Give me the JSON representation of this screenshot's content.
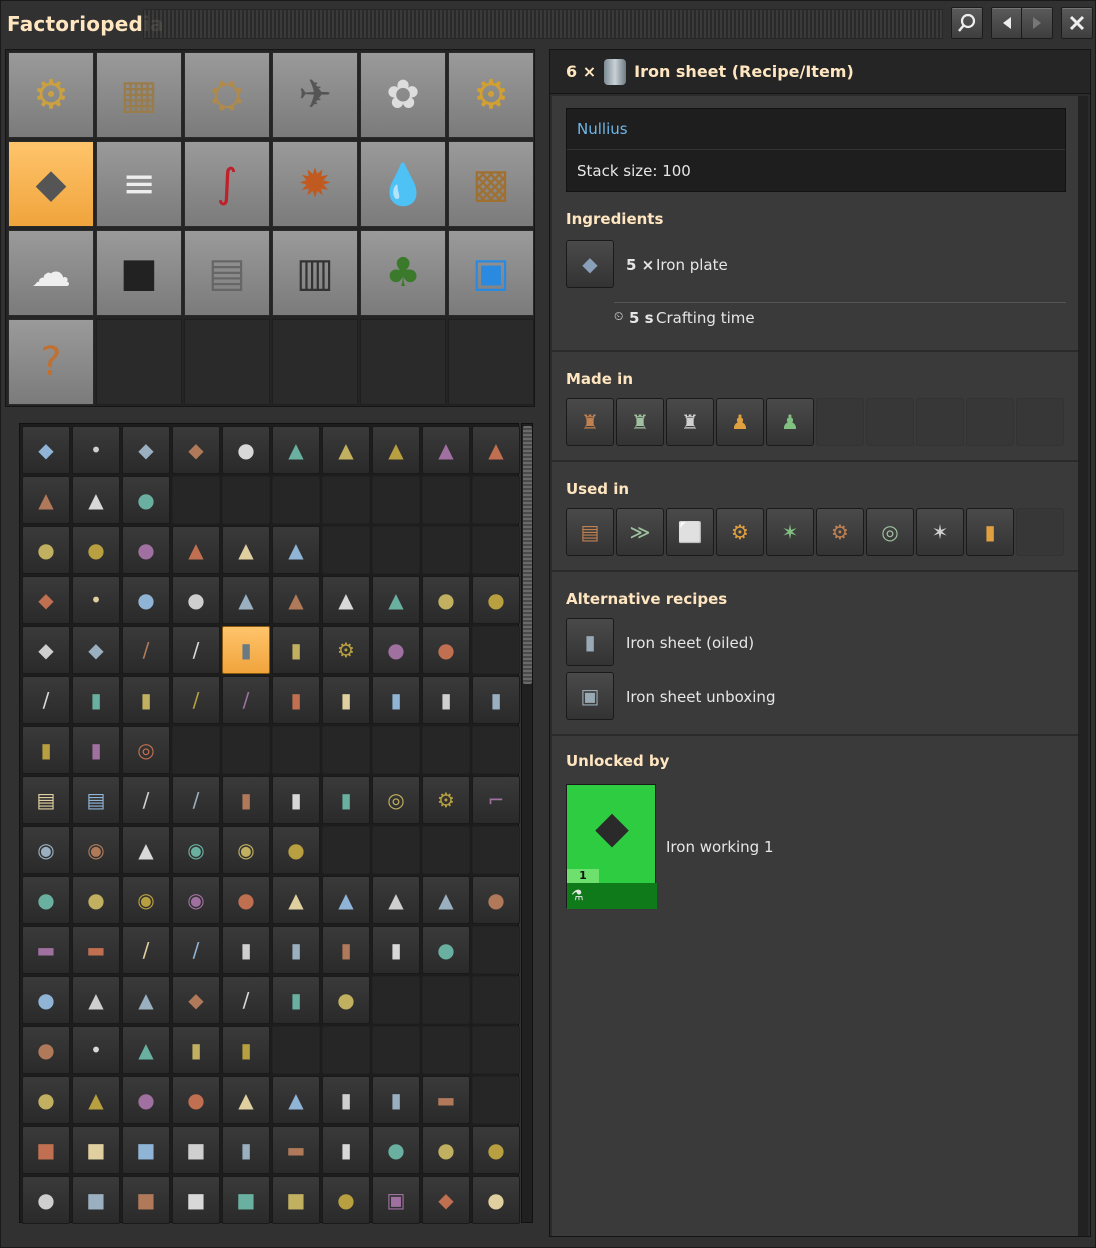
{
  "window": {
    "title": "Factoriopedia"
  },
  "toolbar": {
    "search_icon": "search-icon",
    "back_icon": "triangle-left-icon",
    "forward_icon": "triangle-right-icon",
    "close_icon": "close-icon"
  },
  "categories": [
    {
      "icon": "⚙",
      "color": "#caa040"
    },
    {
      "icon": "▦",
      "color": "#9a7b4a"
    },
    {
      "icon": "⛭",
      "color": "#b08a4a"
    },
    {
      "icon": "✈",
      "color": "#555"
    },
    {
      "icon": "✿",
      "color": "#ddd"
    },
    {
      "icon": "⚙",
      "color": "#d2a030"
    },
    {
      "icon": "◆",
      "color": "#555",
      "selected": true
    },
    {
      "icon": "≡",
      "color": "#eee"
    },
    {
      "icon": "∫",
      "color": "#c0202a"
    },
    {
      "icon": "✹",
      "color": "#c05a20"
    },
    {
      "icon": "💧",
      "color": "#2aa0c0"
    },
    {
      "icon": "▩",
      "color": "#a07030"
    },
    {
      "icon": "☁",
      "color": "#eee"
    },
    {
      "icon": "■",
      "color": "#222"
    },
    {
      "icon": "▤",
      "color": "#666"
    },
    {
      "icon": "▥",
      "color": "#333"
    },
    {
      "icon": "♣",
      "color": "#3a7a2a"
    },
    {
      "icon": "▣",
      "color": "#2a8adf"
    },
    {
      "icon": "?",
      "color": "#c07030"
    }
  ],
  "grid": {
    "rows": [
      [
        "◆",
        "•",
        "◆",
        "◆",
        "●",
        "▲",
        "▲",
        "▲",
        "▲",
        "▲"
      ],
      [
        "▲",
        "▲",
        "●",
        "",
        "",
        "",
        "",
        "",
        "",
        ""
      ],
      [
        "●",
        "●",
        "●",
        "▲",
        "▲",
        "▲",
        "",
        "",
        "",
        ""
      ],
      [
        "◆",
        "•",
        "●",
        "●",
        "▲",
        "▲",
        "▲",
        "▲",
        "●",
        "●"
      ],
      [
        "◆",
        "◆",
        "/",
        "/",
        "▮",
        "▮",
        "⚙",
        "●",
        "●",
        ""
      ],
      [
        "/",
        "▮",
        "▮",
        "/",
        "/",
        "▮",
        "▮",
        "▮",
        "▮",
        "▮"
      ],
      [
        "▮",
        "▮",
        "◎",
        "",
        "",
        "",
        "",
        "",
        "",
        ""
      ],
      [
        "▤",
        "▤",
        "/",
        "/",
        "▮",
        "▮",
        "▮",
        "◎",
        "⚙",
        "⌐"
      ],
      [
        "◉",
        "◉",
        "▲",
        "◉",
        "◉",
        "●",
        "",
        "",
        "",
        ""
      ],
      [
        "●",
        "●",
        "◉",
        "◉",
        "●",
        "▲",
        "▲",
        "▲",
        "▲",
        "●"
      ],
      [
        "▬",
        "▬",
        "/",
        "/",
        "▮",
        "▮",
        "▮",
        "▮",
        "●",
        ""
      ],
      [
        "●",
        "▲",
        "▲",
        "◆",
        "/",
        "▮",
        "●",
        "",
        "",
        ""
      ],
      [
        "●",
        "•",
        "▲",
        "▮",
        "▮",
        "",
        "",
        "",
        "",
        ""
      ],
      [
        "●",
        "▲",
        "●",
        "●",
        "▲",
        "▲",
        "▮",
        "▮",
        "▬",
        ""
      ],
      [
        "■",
        "■",
        "■",
        "■",
        "▮",
        "▬",
        "▮",
        "●",
        "●",
        "●"
      ],
      [
        "●",
        "■",
        "■",
        "■",
        "■",
        "■",
        "●",
        "▣",
        "◆",
        "●"
      ]
    ],
    "selected": [
      4,
      4
    ]
  },
  "detail": {
    "header": {
      "count": "6 ×",
      "name": "Iron sheet (Recipe/Item)"
    },
    "mod": "Nullius",
    "stack": "Stack size: 100",
    "ingredients": {
      "heading": "Ingredients",
      "items": [
        {
          "count": "5 ×",
          "name": "Iron plate"
        }
      ],
      "time_value": "5 s",
      "time_label": "Crafting time"
    },
    "made_in": {
      "heading": "Made in",
      "slots": [
        "♜",
        "♜",
        "♜",
        "♟",
        "♟"
      ]
    },
    "used_in": {
      "heading": "Used in",
      "slots": [
        "▤",
        "≫",
        "⬜",
        "⚙",
        "✶",
        "⚙",
        "◎",
        "✶",
        "▮"
      ]
    },
    "alternative": {
      "heading": "Alternative recipes",
      "items": [
        {
          "name": "Iron sheet (oiled)"
        },
        {
          "name": "Iron sheet unboxing"
        }
      ]
    },
    "unlocked_by": {
      "heading": "Unlocked by",
      "tech": "Iron working 1",
      "level": "1"
    }
  }
}
